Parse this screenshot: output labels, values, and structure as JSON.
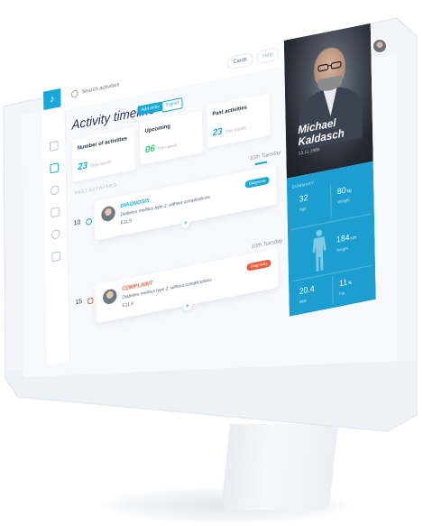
{
  "topbar": {
    "search_placeholder": "Search activities",
    "cards_button": "Cards",
    "help_button": "Help"
  },
  "header": {
    "title": "Activity timeline",
    "pill_primary": "Add entry",
    "pill_secondary": "Export"
  },
  "stats": [
    {
      "label": "Number of activities",
      "value": "23",
      "sub": "This month",
      "color": "#1aa9d6"
    },
    {
      "label": "Upcoming",
      "value": "06",
      "sub": "This week",
      "color": "#2ecc71"
    },
    {
      "label": "Past activities",
      "value": "23",
      "sub": "This month",
      "color": "#1aa9d6"
    }
  ],
  "timeline": {
    "section_label": "PAST ACTIVITIES",
    "groups": [
      {
        "date": "10th Tuesday",
        "rail_day": "10",
        "card": {
          "title": "DIAGNOSIS",
          "title_color": "#1aa9d6",
          "desc": "Diabetes mellitus type 2, without complications",
          "code": "E11.9",
          "badge": "Diagnosis",
          "badge_color": "#1aa9d6"
        }
      },
      {
        "date": "10th Tuesday",
        "rail_day": "15",
        "card": {
          "title": "COMPLAINT",
          "title_color": "#f05a3c",
          "desc": "Diabetes mellitus type 2, without complications",
          "code": "E11.9",
          "badge": "Diagnosis",
          "badge_color": "#f05a3c"
        }
      }
    ]
  },
  "profile": {
    "first_name": "Michael",
    "last_name": "Kaldasch",
    "dob": "13.11.1985",
    "summary_label": "SUMMARY",
    "metrics": {
      "age": {
        "value": "32",
        "unit": "",
        "label": "Age"
      },
      "weight": {
        "value": "80",
        "unit": "kg",
        "label": "Weight"
      },
      "height": {
        "value": "184",
        "unit": "cm",
        "label": "Height"
      },
      "bmi": {
        "value": "20.4",
        "unit": "",
        "label": "BMI"
      },
      "fat": {
        "value": "11",
        "unit": "%",
        "label": "Fat"
      }
    }
  },
  "colors": {
    "accent": "#1aa9d6",
    "panel_blue": "#1c9fd0",
    "complaint": "#f05a3c",
    "upcoming": "#2ecc71"
  },
  "icons": [
    "logo-icon",
    "search-icon",
    "bell-icon",
    "avatar",
    "plus-icon",
    "person-silhouette-icon"
  ]
}
